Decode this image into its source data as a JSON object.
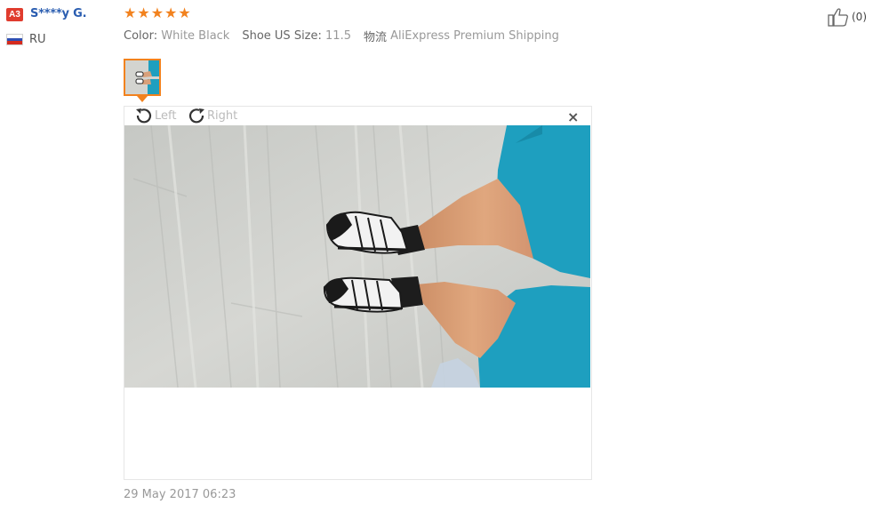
{
  "user": {
    "badge": "A3",
    "name": "S****y G.",
    "country": "RU"
  },
  "review": {
    "rating": 5,
    "stars": [
      "★",
      "★",
      "★",
      "★",
      "★"
    ],
    "color_label": "Color:",
    "color_value": "White Black",
    "size_label": "Shoe US Size:",
    "size_value": "11.5",
    "shipping_label": "物流",
    "shipping_value": "AliExpress Premium Shipping",
    "date": "29 May 2017 06:23"
  },
  "viewer": {
    "rotate_left": "Left",
    "rotate_right": "Right",
    "close": "×"
  },
  "like": {
    "count": "(0)"
  },
  "colors": {
    "accent": "#f2821e",
    "user_link": "#2a5db0",
    "badge": "#e03c2e",
    "shorts": "#1e9fbf",
    "floor": "#cfd0cc"
  }
}
